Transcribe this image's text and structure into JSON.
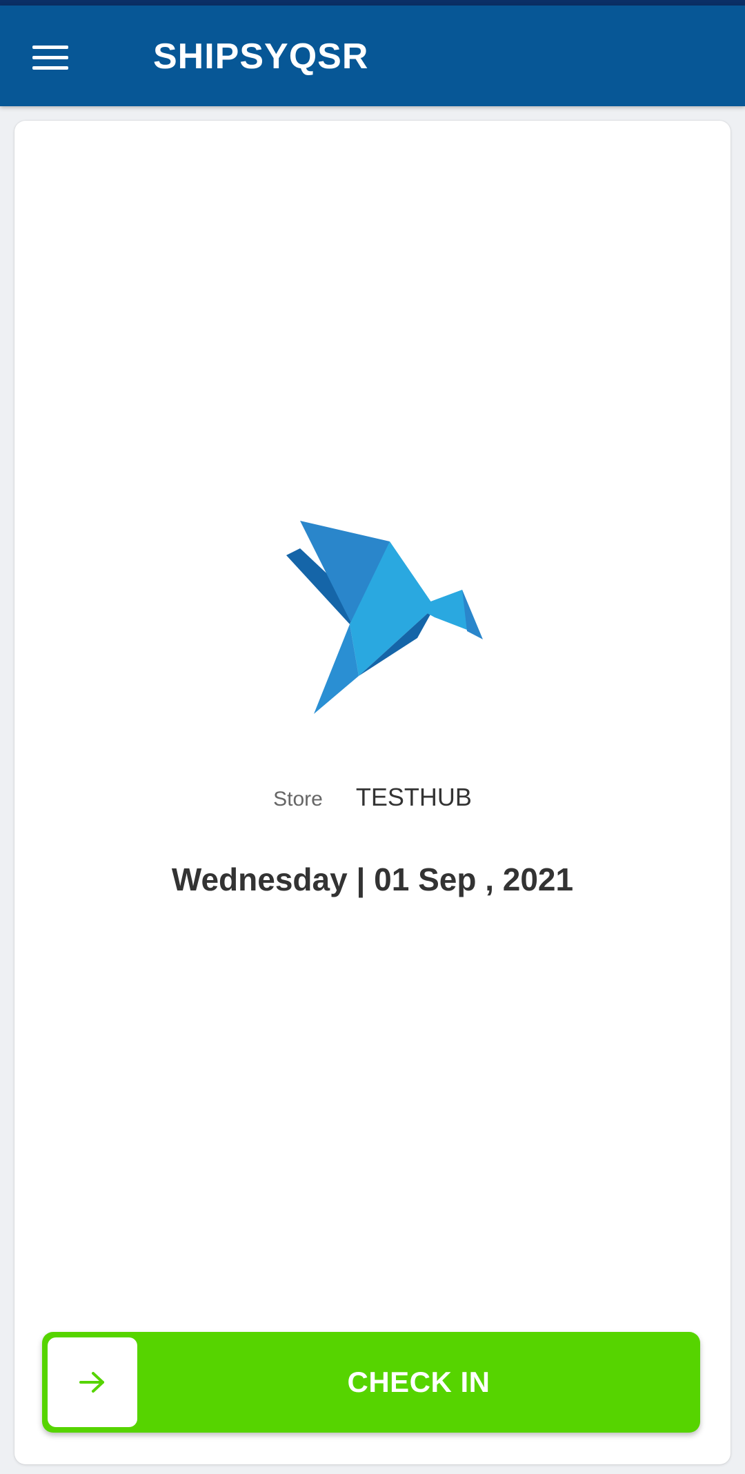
{
  "app_bar": {
    "title": "SHIPSYQSR",
    "menu_icon": "hamburger-menu-icon"
  },
  "logo": {
    "icon": "origami-bird-logo",
    "colors": {
      "light": "#2AA8E0",
      "mid": "#2A86CB",
      "dark": "#1565A8"
    }
  },
  "store": {
    "label": "Store",
    "value": "TESTHUB"
  },
  "date": {
    "text": "Wednesday | 01 Sep , 2021"
  },
  "check_in": {
    "label": "CHECK IN",
    "icon": "arrow-right-icon",
    "color": "#56D400"
  },
  "theme": {
    "primary": "#075796",
    "status_bar": "#0B2F66",
    "text_dark": "#333333",
    "text_muted": "#666666"
  }
}
